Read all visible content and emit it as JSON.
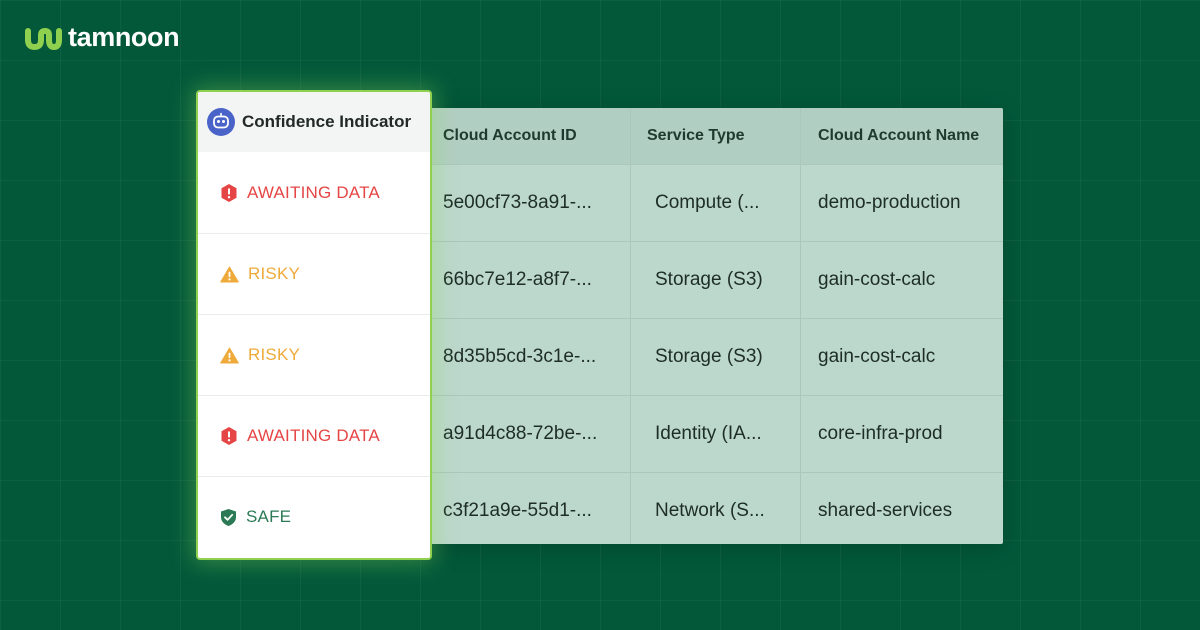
{
  "brand": {
    "name": "tamnoon",
    "accent_color": "#8fd14f",
    "logo_icon": "tamnoon-wave-icon"
  },
  "confidence": {
    "header_label": "Confidence Indicator",
    "header_icon": "robot-badge-icon",
    "rows": [
      {
        "status": "AWAITING DATA",
        "icon": "alert-hexagon-icon",
        "color": "#e64545"
      },
      {
        "status": "RISKY",
        "icon": "warning-triangle-icon",
        "color": "#eeaa3a"
      },
      {
        "status": "RISKY",
        "icon": "warning-triangle-icon",
        "color": "#eeaa3a"
      },
      {
        "status": "AWAITING DATA",
        "icon": "alert-hexagon-icon",
        "color": "#e64545"
      },
      {
        "status": "SAFE",
        "icon": "shield-check-icon",
        "color": "#2b7a55"
      }
    ]
  },
  "table": {
    "columns": [
      "Cloud Account ID",
      "Service Type",
      "Cloud Account Name"
    ],
    "rows": [
      [
        "5e00cf73-8a91-...",
        "Compute (...",
        "demo-production"
      ],
      [
        "66bc7e12-a8f7-...",
        "Storage (S3)",
        "gain-cost-calc"
      ],
      [
        "8d35b5cd-3c1e-...",
        "Storage (S3)",
        "gain-cost-calc"
      ],
      [
        "a91d4c88-72be-...",
        "Identity (IA...",
        "core-infra-prod"
      ],
      [
        "c3f21a9e-55d1-...",
        "Network (S...",
        "shared-services"
      ]
    ]
  }
}
